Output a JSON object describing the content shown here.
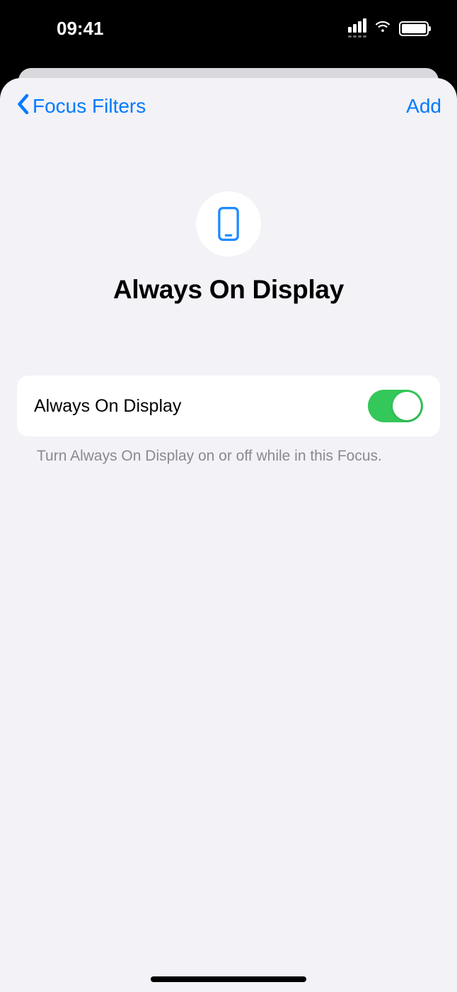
{
  "status": {
    "time": "09:41"
  },
  "nav": {
    "back_label": "Focus Filters",
    "action_label": "Add"
  },
  "hero": {
    "title": "Always On Display"
  },
  "setting": {
    "label": "Always On Display",
    "enabled": true,
    "footer": "Turn Always On Display on or off while in this Focus."
  }
}
